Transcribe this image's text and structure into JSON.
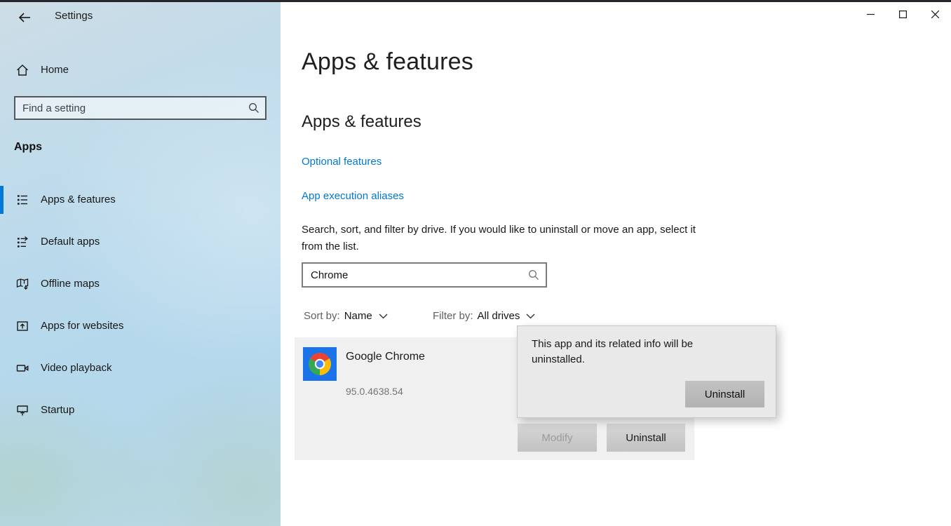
{
  "window": {
    "title": "Settings",
    "controls": {
      "minimize": "minimize",
      "maximize": "maximize",
      "close": "close"
    }
  },
  "sidebar": {
    "home_label": "Home",
    "search_placeholder": "Find a setting",
    "section_header": "Apps",
    "items": [
      {
        "label": "Apps & features",
        "selected": true
      },
      {
        "label": "Default apps",
        "selected": false
      },
      {
        "label": "Offline maps",
        "selected": false
      },
      {
        "label": "Apps for websites",
        "selected": false
      },
      {
        "label": "Video playback",
        "selected": false
      },
      {
        "label": "Startup",
        "selected": false
      }
    ]
  },
  "main": {
    "page_title": "Apps & features",
    "section_title": "Apps & features",
    "links": [
      "Optional features",
      "App execution aliases"
    ],
    "description": "Search, sort, and filter by drive. If you would like to uninstall or move an app, select it from the list.",
    "search_value": "Chrome",
    "sort_label": "Sort by:",
    "sort_value": "Name",
    "filter_label": "Filter by:",
    "filter_value": "All drives",
    "app": {
      "name": "Google Chrome",
      "version": "95.0.4638.54",
      "modify_label": "Modify",
      "uninstall_label": "Uninstall"
    }
  },
  "popup": {
    "message": "This app and its related info will be uninstalled.",
    "uninstall_label": "Uninstall"
  },
  "colors": {
    "accent": "#0078d7",
    "link": "#0078d7",
    "row_background": "#f0f0f0",
    "popup_background": "#e9e9e9",
    "chrome_red": "#ea4335",
    "chrome_green": "#34a853",
    "chrome_yellow": "#fbbc05",
    "chrome_blue": "#4285f4",
    "chrome_tile_blue": "#1a73e8"
  }
}
